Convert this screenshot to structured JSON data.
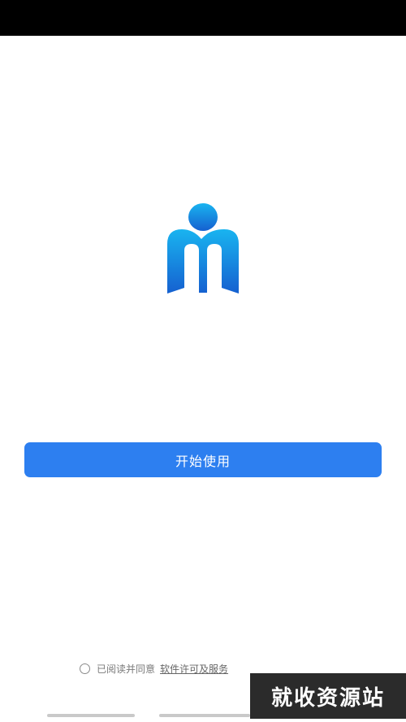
{
  "app": {
    "logo_icon": "m-person-logo-icon",
    "accent_color": "#2d7ff0"
  },
  "start": {
    "label": "开始使用"
  },
  "agreement": {
    "text": "已阅读并同意",
    "link": "软件许可及服务"
  },
  "watermark": {
    "text": "就收资源站"
  }
}
